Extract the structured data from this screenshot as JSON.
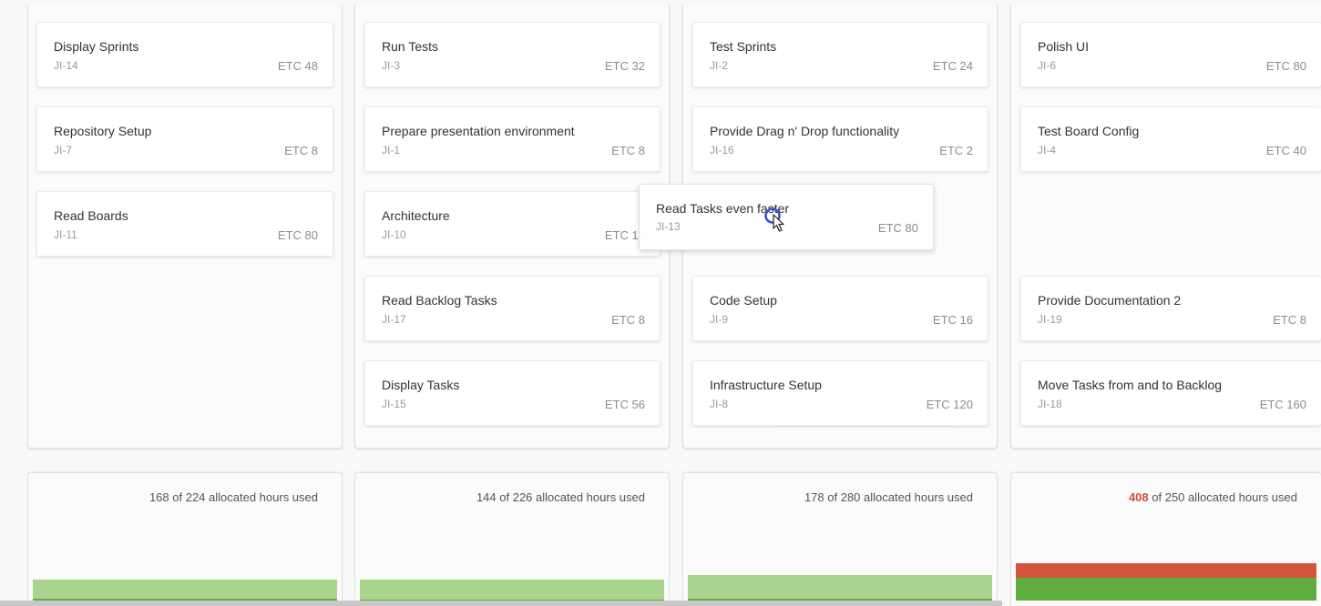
{
  "colors": {
    "alloc_bar": "#a9d48e",
    "used_bar": "#5fad41",
    "over_bar": "#d4533d",
    "over_text": "#d64b32"
  },
  "columns": [
    {
      "cards": [
        {
          "title": "Display Sprints",
          "key": "JI-14",
          "etc": "ETC 48"
        },
        {
          "title": "Repository Setup",
          "key": "JI-7",
          "etc": "ETC 8"
        },
        {
          "title": "Read Boards",
          "key": "JI-11",
          "etc": "ETC 80"
        }
      ],
      "summary": {
        "used": "168",
        "rest": " of 224 allocated hours used",
        "used_hours": 168,
        "allocated_hours": 224,
        "over": false
      }
    },
    {
      "cards": [
        {
          "title": "Run Tests",
          "key": "JI-3",
          "etc": "ETC 32"
        },
        {
          "title": "Prepare presentation environment",
          "key": "JI-1",
          "etc": "ETC 8"
        },
        {
          "title": "Architecture",
          "key": "JI-10",
          "etc": "ETC 16"
        },
        {
          "title": "Read Backlog Tasks",
          "key": "JI-17",
          "etc": "ETC 8"
        },
        {
          "title": "Display Tasks",
          "key": "JI-15",
          "etc": "ETC 56"
        }
      ],
      "summary": {
        "used": "144",
        "rest": " of 226 allocated hours used",
        "used_hours": 144,
        "allocated_hours": 226,
        "over": false
      }
    },
    {
      "cards": [
        {
          "title": "Test Sprints",
          "key": "JI-2",
          "etc": "ETC 24"
        },
        {
          "title": "Provide Drag n' Drop functionality",
          "key": "JI-16",
          "etc": "ETC 2"
        },
        {
          "title": "Code Setup",
          "key": "JI-9",
          "etc": "ETC 16"
        },
        {
          "title": "Infrastructure Setup",
          "key": "JI-8",
          "etc": "ETC 120"
        }
      ],
      "summary": {
        "used": "178",
        "rest": " of 280 allocated hours used",
        "used_hours": 178,
        "allocated_hours": 280,
        "over": false
      }
    },
    {
      "cards": [
        {
          "title": "Polish UI",
          "key": "JI-6",
          "etc": "ETC 80"
        },
        {
          "title": "Test Board Config",
          "key": "JI-4",
          "etc": "ETC 40"
        },
        {
          "title": "Provide Documentation 2",
          "key": "JI-19",
          "etc": "ETC 8"
        },
        {
          "title": "Move Tasks from and to Backlog",
          "key": "JI-18",
          "etc": "ETC 160"
        }
      ],
      "summary": {
        "used": "408",
        "rest": " of 250 allocated hours used",
        "used_hours": 408,
        "allocated_hours": 250,
        "over": true
      }
    }
  ],
  "dragging_card": {
    "title": "Read Tasks even faster",
    "key": "JI-13",
    "etc": "ETC 80"
  }
}
